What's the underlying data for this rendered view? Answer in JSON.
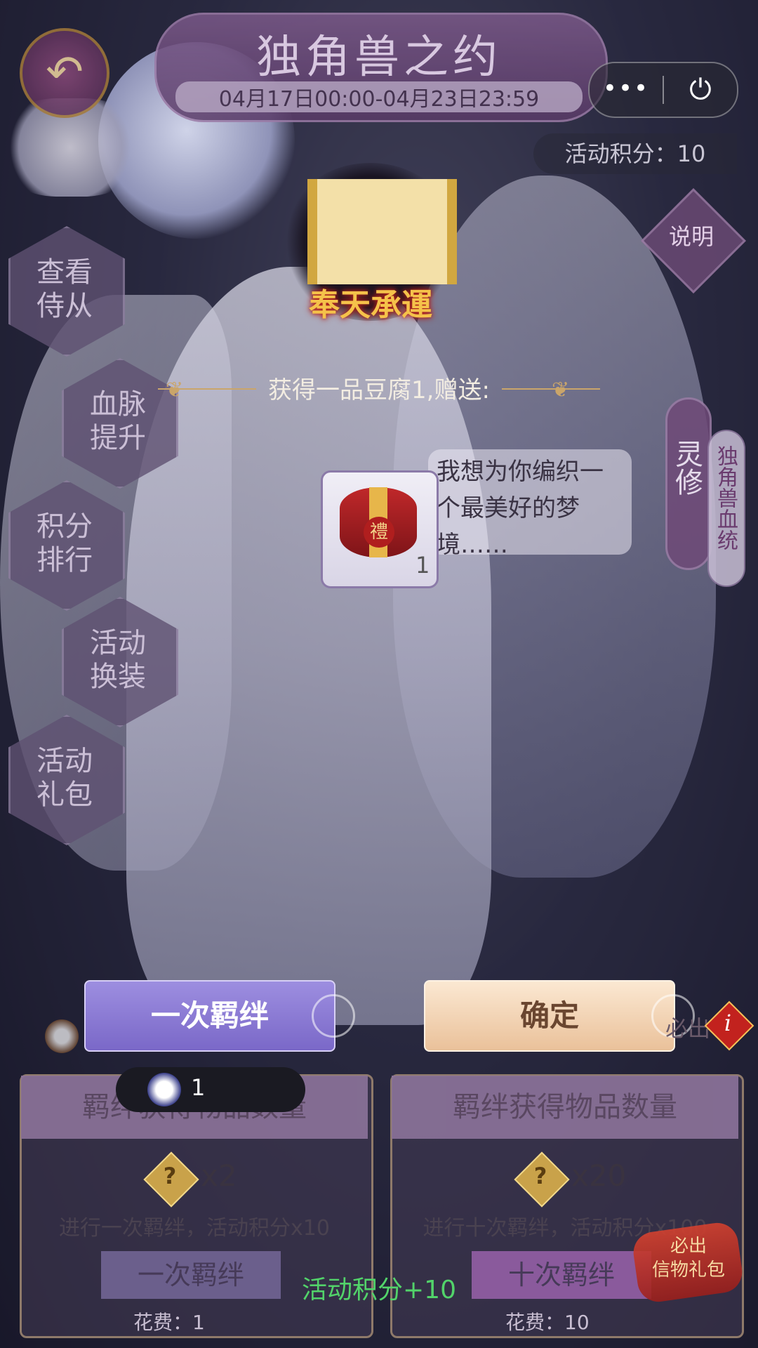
{
  "header": {
    "title": "独角兽之约",
    "date_range": "04月17日00:00-04月23日23:59",
    "back_icon": "back-arrow-icon",
    "more_label": "•••",
    "power_icon": "⏻"
  },
  "score_chip": "活动积分：10",
  "explain_label": "说明",
  "left_menu": [
    {
      "label_line1": "查看",
      "label_line2": "侍从"
    },
    {
      "label_line1": "血脉",
      "label_line2": "提升"
    },
    {
      "label_line1": "积分",
      "label_line2": "排行"
    },
    {
      "label_line1": "活动",
      "label_line2": "换装"
    },
    {
      "label_line1": "活动",
      "label_line2": "礼包"
    }
  ],
  "right_menu": {
    "lingxiu": "灵修",
    "bloodline": "独角兽血统"
  },
  "reward": {
    "scroll_title": "奉天承運",
    "text": "获得一品豆腐1,赠送:",
    "item_char": "禮",
    "item_count": "1"
  },
  "speech": "我想为你编织一个最美好的梦境……",
  "buttons": {
    "bond_once": "一次羁绊",
    "confirm": "确定"
  },
  "token": {
    "count": "1"
  },
  "must_label": "必出",
  "info_icon": "i",
  "panels": [
    {
      "header": "羁绊获得物品数量",
      "qmark": "?",
      "multiplier": "x2",
      "desc": "进行一次羁绊，活动积分x10",
      "button": "一次羁绊",
      "cost": "花费：1"
    },
    {
      "header": "羁绊获得物品数量",
      "qmark": "?",
      "multiplier": "x20",
      "desc": "进行十次羁绊，活动积分x100",
      "button": "十次羁绊",
      "cost": "花费：10"
    }
  ],
  "gift_badge": {
    "line1": "必出",
    "line2": "信物礼包"
  },
  "float_text": "活动积分+10",
  "colors": {
    "bond_button": "#8c7ddb",
    "confirm_button": "#f3d5b6",
    "float_text": "#52d36a"
  }
}
